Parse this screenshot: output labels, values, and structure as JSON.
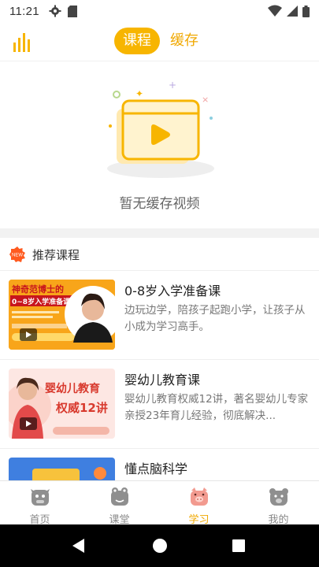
{
  "status_bar": {
    "time": "11:21"
  },
  "top_nav": {
    "tab_course": "课程",
    "tab_cache": "缓存",
    "active_tab": "课程"
  },
  "empty_state": {
    "message": "暂无缓存视频"
  },
  "recommended": {
    "badge": "NEW",
    "title": "推荐课程",
    "courses": [
      {
        "title": "0-8岁入学准备课",
        "desc": "边玩边学，陪孩子起跑小学，让孩子从小成为学习高手。",
        "thumb_title": "神奇范博士的",
        "thumb_subtitle": "0~8岁入学准备课"
      },
      {
        "title": "婴幼儿教育课",
        "desc": "婴幼儿教育权威12讲，著名婴幼儿专家亲授23年育儿经验，彻底解决...",
        "thumb_title": "婴幼儿教育",
        "thumb_subtitle": "权威12讲"
      },
      {
        "title": "懂点脑科学",
        "desc": "",
        "thumb_title": "",
        "thumb_subtitle": ""
      }
    ]
  },
  "tab_bar": {
    "items": [
      {
        "label": "首页"
      },
      {
        "label": "课堂"
      },
      {
        "label": "学习"
      },
      {
        "label": "我的"
      }
    ],
    "active": "学习"
  },
  "colors": {
    "accent": "#f7b500",
    "accent_text": "#f0a800",
    "new_badge": "#ff5a1f"
  }
}
